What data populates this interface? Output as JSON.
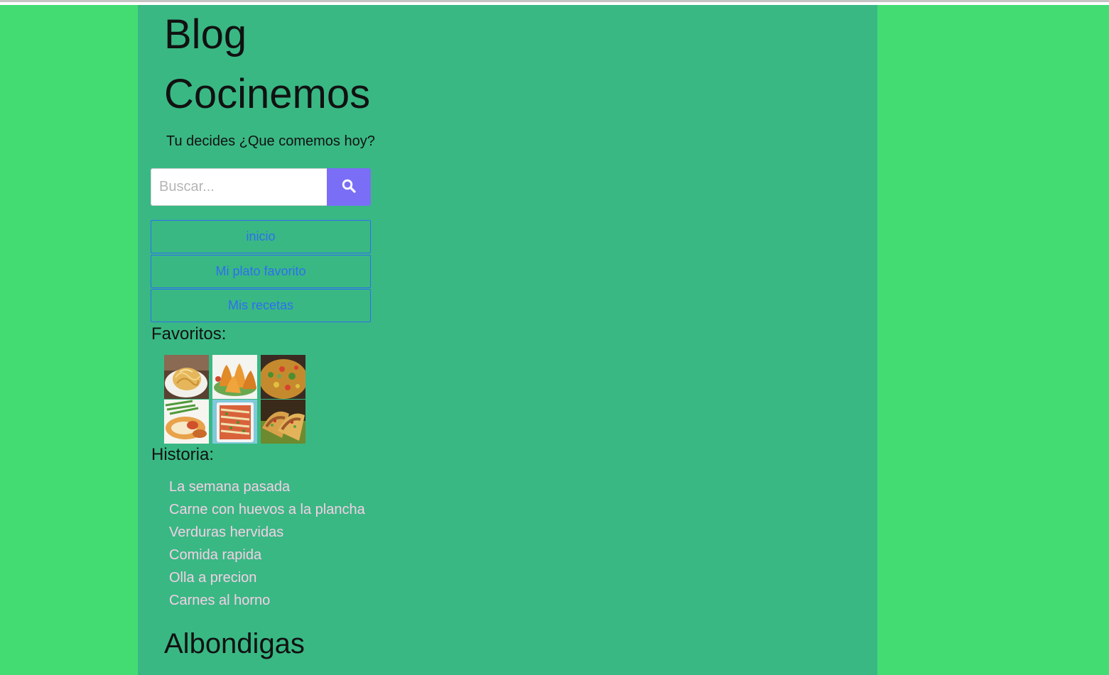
{
  "header": {
    "title": "Blog Cocinemos",
    "tagline": "Tu decides ¿Que comemos hoy?"
  },
  "search": {
    "placeholder": "Buscar...",
    "value": "",
    "button_icon": "search-icon"
  },
  "nav": {
    "items": [
      {
        "label": "inicio"
      },
      {
        "label": "Mi plato favorito"
      },
      {
        "label": "Mis recetas"
      }
    ]
  },
  "favoritos": {
    "heading": "Favoritos:",
    "images": [
      {
        "name": "noodles-image"
      },
      {
        "name": "coxinha-image"
      },
      {
        "name": "paella-image"
      },
      {
        "name": "stuffed-chicken-image"
      },
      {
        "name": "enchiladas-image"
      },
      {
        "name": "tacos-image"
      }
    ]
  },
  "historia": {
    "heading": "Historia:",
    "links": [
      {
        "label": "La semana pasada"
      },
      {
        "label": "Carne con huevos a la plancha"
      },
      {
        "label": "Verduras hervidas"
      },
      {
        "label": "Comida rapida"
      },
      {
        "label": "Olla a precion"
      },
      {
        "label": "Carnes al horno"
      }
    ]
  },
  "post": {
    "title": "Albondigas"
  },
  "colors": {
    "page_background": "#43dc73",
    "container_background": "#39b884",
    "search_button": "#7b6ef6",
    "nav_link": "#2f6ef0",
    "historia_link": "#f5cfe6"
  }
}
